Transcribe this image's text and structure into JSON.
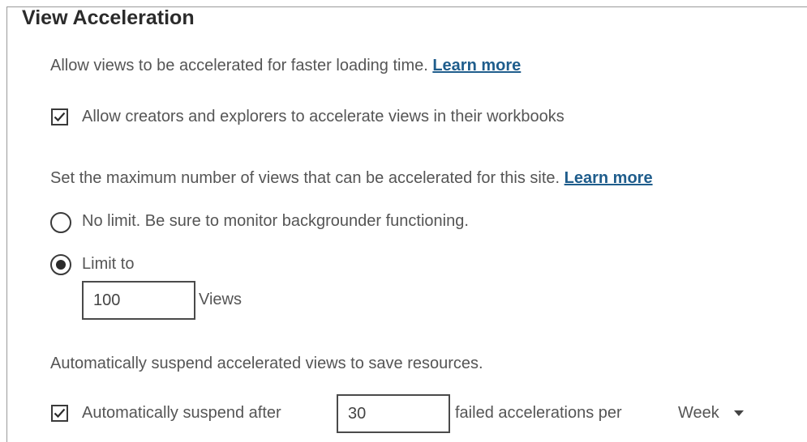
{
  "section": {
    "title": "View Acceleration",
    "intro": {
      "text": "Allow views to be accelerated for faster loading time.",
      "link": "Learn more"
    },
    "allow_creators": {
      "label": "Allow creators and explorers to accelerate views in their workbooks",
      "checked": true
    },
    "max_views": {
      "text": "Set the maximum number of views that can be accelerated for this site.",
      "link": "Learn more",
      "no_limit_label": "No limit. Be sure to monitor backgrounder functioning.",
      "no_limit_selected": false,
      "limit_label": "Limit to",
      "limit_selected": true,
      "limit_value": "100",
      "views_unit": "Views"
    },
    "suspend": {
      "text": "Automatically suspend accelerated views to save resources.",
      "checkbox_label": "Automatically suspend after",
      "checked": true,
      "failed_count": "30",
      "failed_suffix": "failed accelerations per",
      "period": "Week"
    }
  }
}
